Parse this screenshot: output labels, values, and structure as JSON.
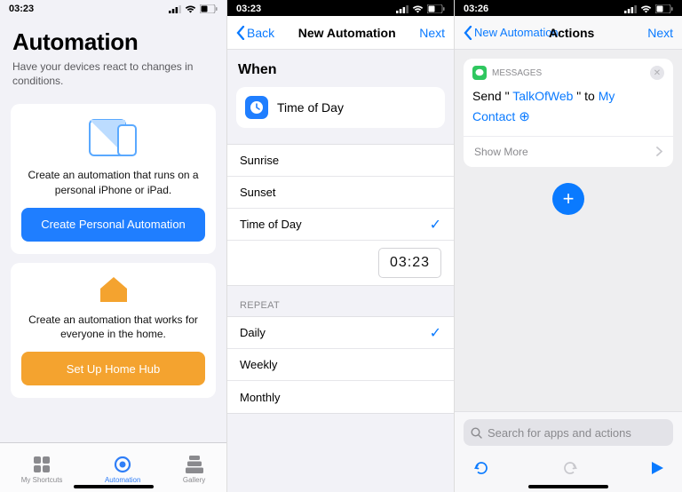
{
  "s1": {
    "time": "03:23",
    "title": "Automation",
    "subtitle": "Have your devices react to changes in conditions.",
    "card1": {
      "text": "Create an automation that runs on a personal iPhone or iPad.",
      "button": "Create Personal Automation"
    },
    "card2": {
      "text": "Create an automation that works for everyone in the home.",
      "button": "Set Up Home Hub"
    },
    "tabs": {
      "shortcuts": "My Shortcuts",
      "automation": "Automation",
      "gallery": "Gallery"
    }
  },
  "s2": {
    "time": "03:23",
    "nav": {
      "back": "Back",
      "title": "New Automation",
      "next": "Next"
    },
    "whenLabel": "When",
    "tile": "Time of Day",
    "options": {
      "sunrise": "Sunrise",
      "sunset": "Sunset",
      "tod": "Time of Day"
    },
    "picked": "03:23",
    "repeatLabel": "REPEAT",
    "repeats": {
      "daily": "Daily",
      "weekly": "Weekly",
      "monthly": "Monthly"
    }
  },
  "s3": {
    "time": "03:26",
    "nav": {
      "back": "New Automation",
      "title": "Actions",
      "next": "Next"
    },
    "msg": {
      "app": "MESSAGES",
      "p1": "Send \" ",
      "text": "TalkOfWeb",
      "p2": " \" to ",
      "contact": "My Contact"
    },
    "showMore": "Show More",
    "searchPlaceholder": "Search for apps and actions"
  }
}
